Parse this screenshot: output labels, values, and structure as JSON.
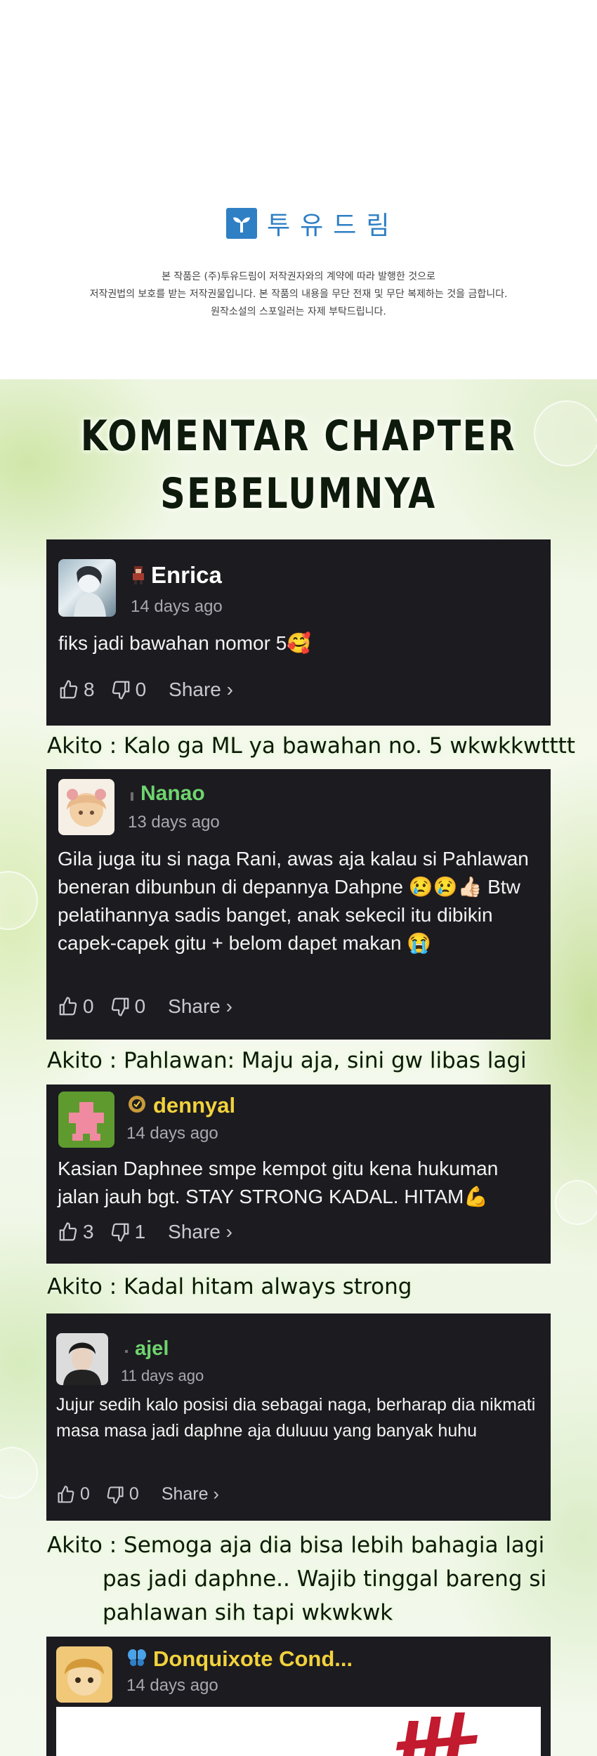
{
  "publisher": {
    "logo_text": "투유드림",
    "notice_lines": [
      "본 작품은 (주)투유드림이 저작권자와의 계약에 따라 발행한 것으로",
      "저작권법의 보호를 받는 저작권물입니다. 본 작품의 내용을 무단 전재 및 무단 복제하는 것을 금합니다.",
      "원작소설의 스포일러는 자제 부탁드립니다."
    ]
  },
  "section": {
    "title_line1": "KOMENTAR CHAPTER",
    "title_line2": "SEBELUMNYA"
  },
  "comments": [
    {
      "username": "Enrica",
      "name_color": "#ffffff",
      "time": "14 days ago",
      "text": "fiks jadi bawahan nomor 5🥰",
      "likes": "8",
      "dislikes": "0",
      "share_label": "Share ›"
    },
    {
      "username": "Nanao",
      "name_color": "#6ed46e",
      "time": "13 days ago",
      "text": "Gila juga itu si naga Rani, awas aja kalau si Pahlawan beneran dibunbun di depannya Dahpne 😢😢👍🏻 Btw pelatihannya sadis banget, anak sekecil itu dibikin capek-capek gitu + belom dapet makan 😭",
      "likes": "0",
      "dislikes": "0",
      "share_label": "Share ›"
    },
    {
      "username": "dennyal",
      "name_color": "#f2d23c",
      "time": "14 days ago",
      "text": "Kasian Daphnee smpe kempot gitu kena hukuman jalan jauh bgt. STAY STRONG KADAL. HITAM💪",
      "likes": "3",
      "dislikes": "1",
      "share_label": "Share ›"
    },
    {
      "username": "ajel",
      "name_color": "#6ed46e",
      "time": "11 days ago",
      "text": "Jujur sedih kalo posisi dia sebagai naga, berharap dia nikmati masa masa jadi daphne aja duluuu yang banyak huhu",
      "likes": "0",
      "dislikes": "0",
      "share_label": "Share ›"
    },
    {
      "username": "Donquixote Cond...",
      "name_color": "#f2d23c",
      "time": "14 days ago"
    }
  ],
  "replies": [
    "Akito : Kalo ga ML ya bawahan no. 5 wkwkkwtttt",
    "Akito : Pahlawan: Maju aja, sini gw libas lagi",
    "Akito : Kadal hitam always strong",
    "Akito : Semoga aja dia bisa lebih bahagia lagi",
    "pas jadi daphne.. Wajib tinggal bareng si",
    "pahlawan sih tapi wkwkwk"
  ]
}
